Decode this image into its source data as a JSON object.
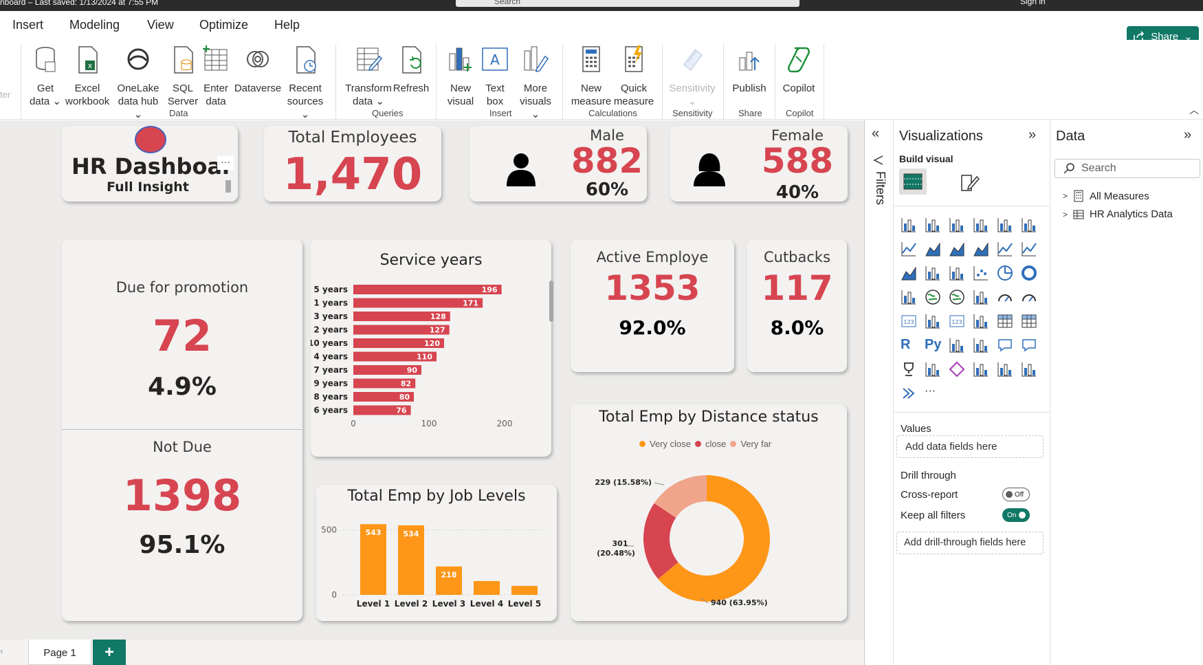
{
  "titlebar": {
    "title": "nboard – Last saved: 1/13/2024 at 7:55 PM",
    "search_placeholder": "Search",
    "user": "Sign in"
  },
  "menu": {
    "tabs": [
      "Insert",
      "Modeling",
      "View",
      "Optimize",
      "Help"
    ],
    "share_label": "Share"
  },
  "ribbon": {
    "buttons": [
      {
        "l1": "Get",
        "l2": "data ⌄"
      },
      {
        "l1": "Excel",
        "l2": "workbook"
      },
      {
        "l1": "OneLake",
        "l2": "data hub ⌄"
      },
      {
        "l1": "SQL",
        "l2": "Server"
      },
      {
        "l1": "Enter",
        "l2": "data"
      },
      {
        "l1": "Dataverse",
        "l2": ""
      },
      {
        "l1": "Recent",
        "l2": "sources ⌄"
      },
      {
        "l1": "Transform",
        "l2": "data ⌄"
      },
      {
        "l1": "Refresh",
        "l2": ""
      },
      {
        "l1": "New",
        "l2": "visual"
      },
      {
        "l1": "Text",
        "l2": "box"
      },
      {
        "l1": "More",
        "l2": "visuals ⌄"
      },
      {
        "l1": "New",
        "l2": "measure"
      },
      {
        "l1": "Quick",
        "l2": "measure"
      },
      {
        "l1": "Sensitivity",
        "l2": "⌄"
      },
      {
        "l1": "Publish",
        "l2": ""
      },
      {
        "l1": "Copilot",
        "l2": ""
      }
    ],
    "groups": [
      "Data",
      "Queries",
      "Insert",
      "Calculations",
      "Sensitivity",
      "Share",
      "Copilot"
    ],
    "left_edge_text": "ter"
  },
  "dashboard": {
    "title": "HR Dashboar",
    "subtitle": "Full Insight",
    "more": "···",
    "total_label": "Total Employees",
    "total_value": "1,470",
    "male_label": "Male",
    "male_value": "882",
    "male_pct": "60%",
    "female_label": "Female",
    "female_value": "588",
    "female_pct": "40%",
    "promo_label": "Due for promotion",
    "promo_value": "72",
    "promo_pct": "4.9%",
    "notdue_label": "Not Due",
    "notdue_value": "1398",
    "notdue_pct": "95.1%",
    "active_label": "Active Employe",
    "active_value": "1353",
    "active_pct": "92.0%",
    "cutbacks_label": "Cutbacks",
    "cutbacks_value": "117",
    "cutbacks_pct": "8.0%"
  },
  "chart_data": [
    {
      "type": "bar",
      "title": "Service years",
      "categories": [
        "5 years",
        "1 years",
        "3 years",
        "2 years",
        "10 years",
        "4 years",
        "7 years",
        "9 years",
        "8 years",
        "6 years"
      ],
      "values": [
        196,
        171,
        128,
        127,
        120,
        110,
        90,
        82,
        80,
        76
      ],
      "xticks": [
        0,
        100,
        200
      ],
      "xlim": [
        0,
        200
      ],
      "color": "#d64550"
    },
    {
      "type": "bar",
      "title": "Total Emp by Job Levels",
      "categories": [
        "Level 1",
        "Level 2",
        "Level 3",
        "Level 4",
        "Level 5"
      ],
      "values": [
        543,
        534,
        218,
        106,
        69
      ],
      "value_labels": [
        "543",
        "534",
        "218",
        "",
        ""
      ],
      "yticks": [
        0,
        500
      ],
      "ylim": [
        0,
        560
      ],
      "color": "#fe9618"
    },
    {
      "type": "pie",
      "title": "Total Emp by Distance status",
      "legend": [
        "Very close",
        "close",
        "Very far"
      ],
      "values": [
        940,
        301,
        229
      ],
      "labels": [
        "940 (63.95%)",
        "301 (20.48%)",
        "229 (15.58%)"
      ],
      "colors": [
        "#fe9618",
        "#d64550",
        "#f0a58b"
      ]
    }
  ],
  "page": {
    "tab": "Page 1",
    "add": "+"
  },
  "filters": {
    "label": "Filters"
  },
  "viz": {
    "title": "Visualizations",
    "build": "Build visual",
    "values_label": "Values",
    "values_well": "Add data fields here",
    "drill": "Drill through",
    "cross_report": "Cross-report",
    "cross_state": "Off",
    "keep_filters": "Keep all filters",
    "keep_state": "On",
    "drill_well": "Add drill-through fields here",
    "r_label": "R",
    "py_label": "Py",
    "more": "···"
  },
  "data_pane": {
    "title": "Data",
    "search_placeholder": "Search",
    "items": [
      "All Measures",
      "HR Analytics Data"
    ]
  },
  "colors": {
    "accent_red": "#d64550",
    "accent_orange": "#fe9618",
    "brand_green": "#117865"
  }
}
